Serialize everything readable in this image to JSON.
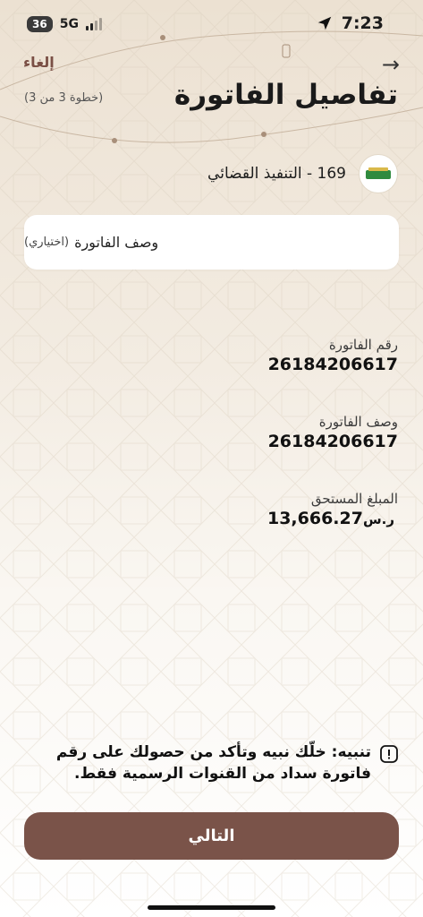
{
  "status_bar": {
    "battery": "36",
    "network": "5G",
    "time": "7:23"
  },
  "header": {
    "cancel_label": "إلغاء",
    "back_icon": "arrow-right-icon",
    "title": "تفاصيل الفاتورة",
    "step": "(خطوة 3 من 3)"
  },
  "biller": {
    "name": "169 - التنفيذ القضائي",
    "logo_icon": "biller-logo-icon"
  },
  "description_field": {
    "label": "وصف الفاتورة",
    "optional": "(اختياري)"
  },
  "details": [
    {
      "label": "رقم الفاتورة",
      "value": "26184206617"
    },
    {
      "label": "وصف الفاتورة",
      "value": "26184206617"
    },
    {
      "label": "المبلغ المستحق",
      "value": "13,666.27",
      "currency_symbol": "ر.س"
    }
  ],
  "warning": {
    "text": "تنبيه: خلّك نبيه وتأكد من حصولك على رقم فاتورة سداد من القنوات الرسمية فقط.",
    "icon": "alert-icon"
  },
  "next_button": {
    "label": "التالي"
  },
  "colors": {
    "accent": "#7a5349",
    "cancel": "#7a4f45"
  }
}
